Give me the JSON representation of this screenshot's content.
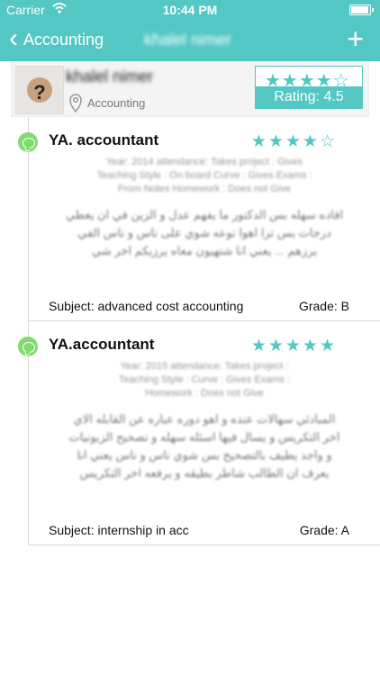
{
  "status": {
    "carrier": "Carrier",
    "time": "10:44 PM",
    "battery_level": 0.95
  },
  "nav": {
    "back_label": "Accounting",
    "title": "khalel nimer",
    "add_icon": "plus-icon"
  },
  "profile": {
    "name": "khalel nimer",
    "department": "Accounting",
    "rating_stars": "★★★★☆",
    "rating_label": "Rating: 4.5",
    "rating": 4.5
  },
  "reviews": [
    {
      "author": "YA. accountant",
      "stars": "★★★★☆",
      "meta": "Year: 2014       attendance: Takes       project : Gives\nTeaching Style : On board       Curve : Gives       Exams :\nFrom Notes     Homework : Does not Give",
      "text": "افاده سهله بس الدكتور ما يفهم عدل و الزين في ان يعطي\nدرجات بس ترا اهوا نوعه شوي على ناس و ناس الفي\nيرزهم ... يعني انا شتهيون معاه يرزيكم اخر شي",
      "subject": "Subject: advanced cost accounting",
      "grade": "Grade: B"
    },
    {
      "author": "YA.accountant",
      "stars": "★★★★★",
      "meta": "Year: 2015       attendance: Takes       project :\nTeaching Style :       Curve : Gives       Exams :\nHomework : Does not Give",
      "text": "المبادئي سهالات عنده و اهو دوره عباره عن القابله الاي\nاخر التكريس و يسال فيها اسئله سهله و تصحيح الزبونيات\nو واجد يطيف بالتصحيح بس شوي ناس و ناس يعني انا\nيعرف ان الطالب شاطر بطيقه و يرفعه اخر التكريس",
      "subject": "Subject: internship in acc",
      "grade": "Grade: A"
    }
  ],
  "colors": {
    "accent": "#53c7c3",
    "comment_icon": "#7fdc6f"
  }
}
